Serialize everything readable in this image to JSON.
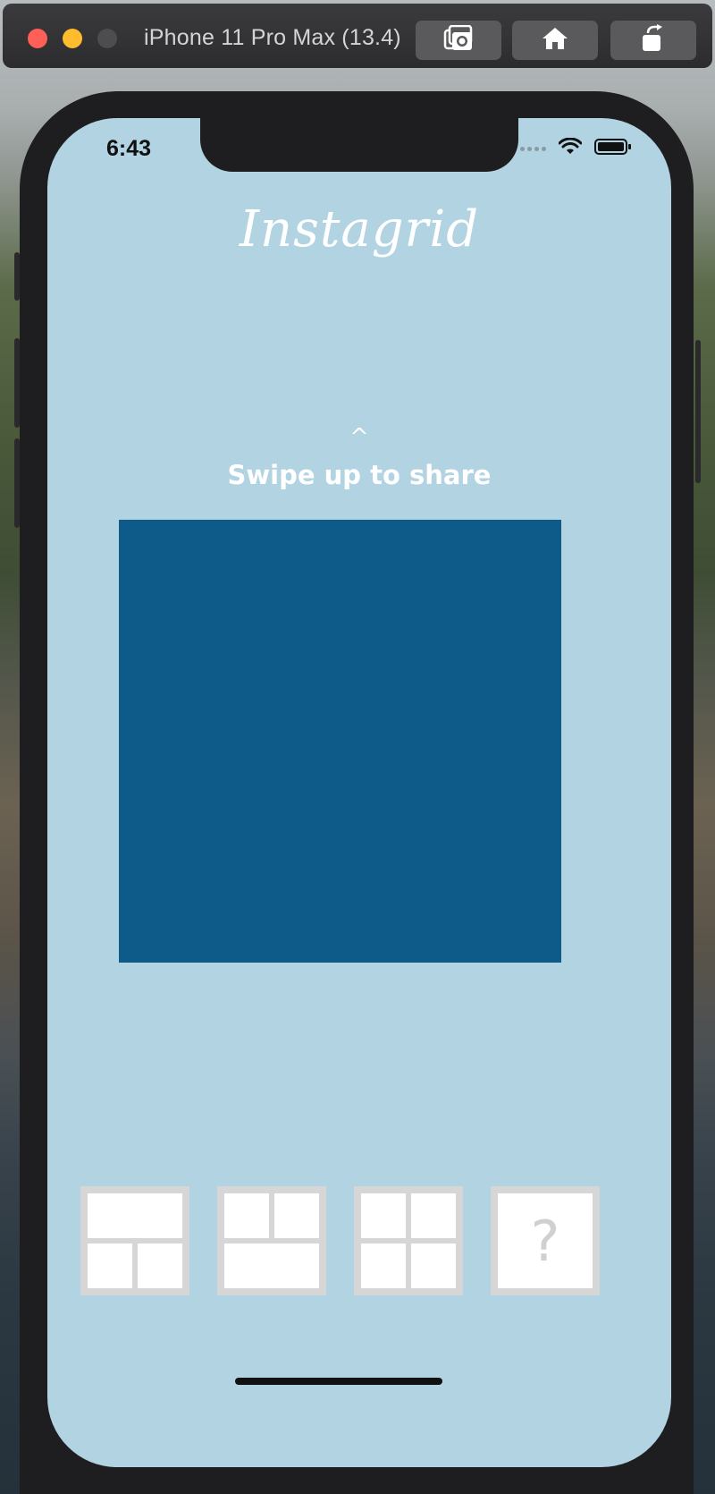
{
  "window": {
    "title": "iPhone 11 Pro Max (13.4)",
    "toolbar": {
      "screenshot_icon": "camera-icon",
      "home_icon": "home-icon",
      "rotate_icon": "rotate-icon"
    }
  },
  "status_bar": {
    "time": "6:43",
    "icons": [
      "signal-icon",
      "wifi-icon",
      "battery-icon"
    ]
  },
  "app": {
    "title": "Instagrid",
    "swipe_arrow": "^",
    "swipe_label": "Swipe up to share",
    "canvas_color": "#0e5a88",
    "background_color": "#b1d3e2",
    "layouts": [
      {
        "name": "layout-one-top-two-bottom",
        "selected": false
      },
      {
        "name": "layout-two-top-one-bottom",
        "selected": false
      },
      {
        "name": "layout-four-squares",
        "selected": false
      },
      {
        "name": "layout-unknown",
        "label": "?",
        "selected": true
      }
    ]
  }
}
